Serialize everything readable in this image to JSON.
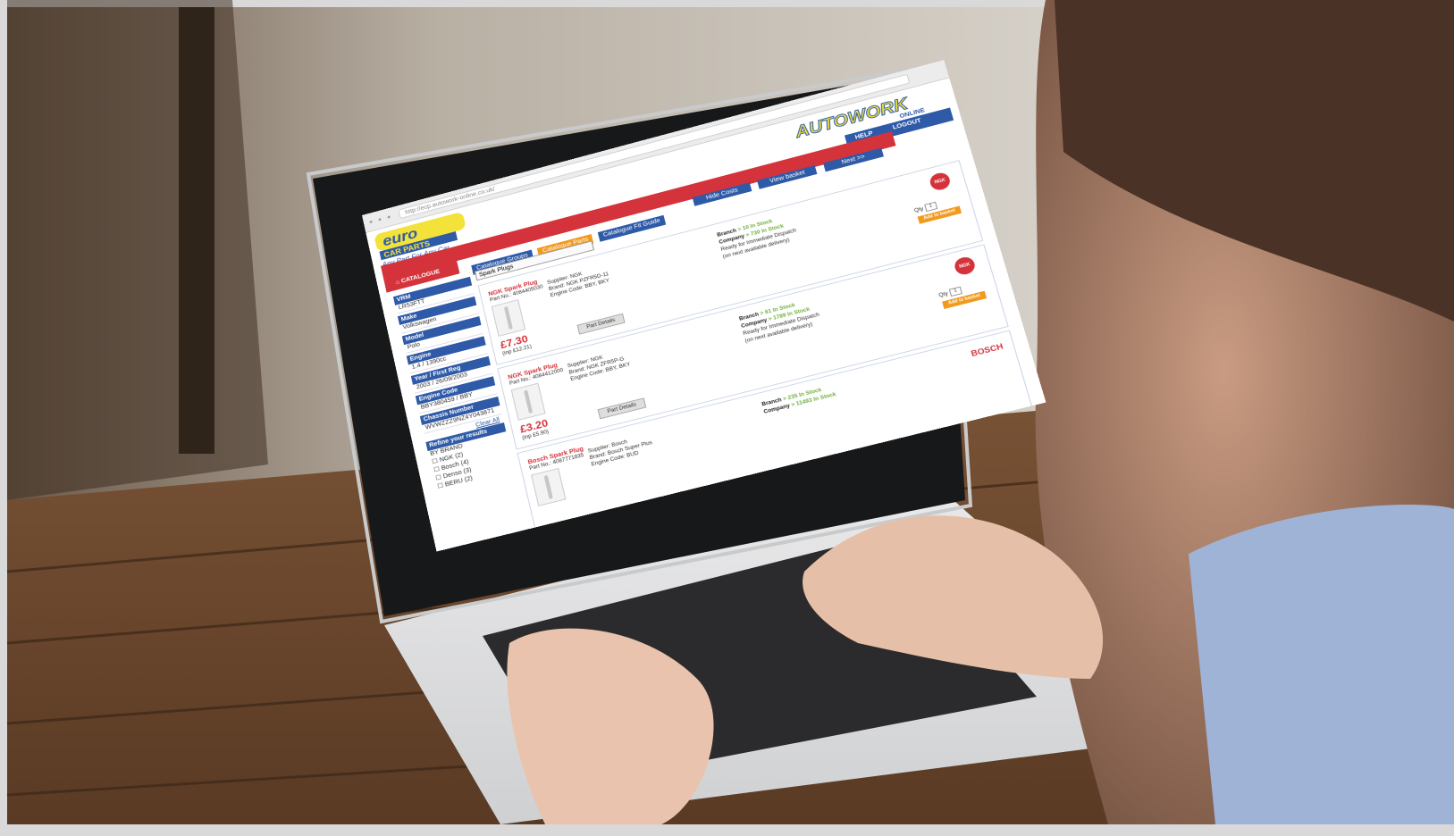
{
  "browser": {
    "url": "http://ecp.autowork-online.co.uk/"
  },
  "logos": {
    "left_title": "euro",
    "left_sub": "CAR PARTS",
    "left_tagline": "Any Part For Any Car",
    "right_title": "AUTOWORK",
    "right_sub": "ONLINE"
  },
  "header": {
    "help": "HELP",
    "logout": "LOGOUT",
    "catalogue": "CATALOGUE"
  },
  "tabs": [
    {
      "label": "Catalogue Groups"
    },
    {
      "label": "Catalogue Parts"
    },
    {
      "label": "Catalogue Fit Guide"
    }
  ],
  "actions": [
    {
      "label": "Hide Costs"
    },
    {
      "label": "View basket"
    },
    {
      "label": "Next >>"
    }
  ],
  "select": {
    "value": "Spark Plugs"
  },
  "sidebar": {
    "fields": [
      {
        "label": "VRM",
        "value": "LR53FTT"
      },
      {
        "label": "Make",
        "value": "Volkswagen"
      },
      {
        "label": "Model",
        "value": "Polo"
      },
      {
        "label": "Engine",
        "value": "1.4 / 1390cc"
      },
      {
        "label": "Year / First Reg",
        "value": "2003 / 26/09/2003"
      },
      {
        "label": "Engine Code",
        "value": "BBY380459 / BBY"
      },
      {
        "label": "Chassis Number",
        "value": "WVWZZZ9NZ4Y043871"
      }
    ],
    "refine_title": "Refine your results",
    "refine_by": "BY BRAND",
    "brands": [
      "NGK (2)",
      "Bosch (4)",
      "Denso (3)",
      "BERU (2)"
    ],
    "clear_all": "Clear All"
  },
  "products": [
    {
      "name": "NGK Spark Plug",
      "part_no": "Part No.: 4084405030",
      "supplier": "Supplier: NGK",
      "brand": "Brand: NGK PZFR5D-11",
      "engine": "Engine Code: BBY, BKY",
      "price": "£7.30",
      "inc_vat": "(inp £12.21)",
      "details": "Part Details",
      "branch": "Branch",
      "branch_stock": "> 10 In Stock",
      "company": "Company",
      "company_stock": "> 730 In Stock",
      "dispatch1": "Ready for Immediate Dispatch",
      "dispatch2": "(on next available delivery)",
      "qty_label": "Qty",
      "qty": "1",
      "add": "Add to basket",
      "brand_logo": "NGK"
    },
    {
      "name": "NGK Spark Plug",
      "part_no": "Part No.: 4084412000",
      "supplier": "Supplier: NGK",
      "brand": "Brand: NGK ZFR5P-G",
      "engine": "Engine Code: BBY, BKY",
      "price": "£3.20",
      "inc_vat": "(inp £5.90)",
      "details": "Part Details",
      "branch": "Branch",
      "branch_stock": "> 61 In Stock",
      "company": "Company",
      "company_stock": "> 1789 In Stock",
      "dispatch1": "Ready for Immediate Dispatch",
      "dispatch2": "(on next available delivery)",
      "qty_label": "Qty",
      "qty": "1",
      "add": "Add to basket",
      "brand_logo": "NGK"
    },
    {
      "name": "Bosch Spark Plug",
      "part_no": "Part No.: 4087771835",
      "supplier": "Supplier: Bosch",
      "brand": "Brand: Bosch Super Plus",
      "engine": "Engine Code: BUD",
      "price": "",
      "inc_vat": "",
      "details": "",
      "branch": "Branch",
      "branch_stock": "> 235 In Stock",
      "company": "Company",
      "company_stock": "> 11493 In Stock",
      "dispatch1": "",
      "dispatch2": "",
      "qty_label": "",
      "qty": "",
      "add": "",
      "brand_logo": "BOSCH"
    }
  ],
  "colors": {
    "red": "#d5333b",
    "blue": "#2e5aa8",
    "orange": "#f29a1e",
    "green": "#6fb03b",
    "yellow": "#f3e23a"
  }
}
